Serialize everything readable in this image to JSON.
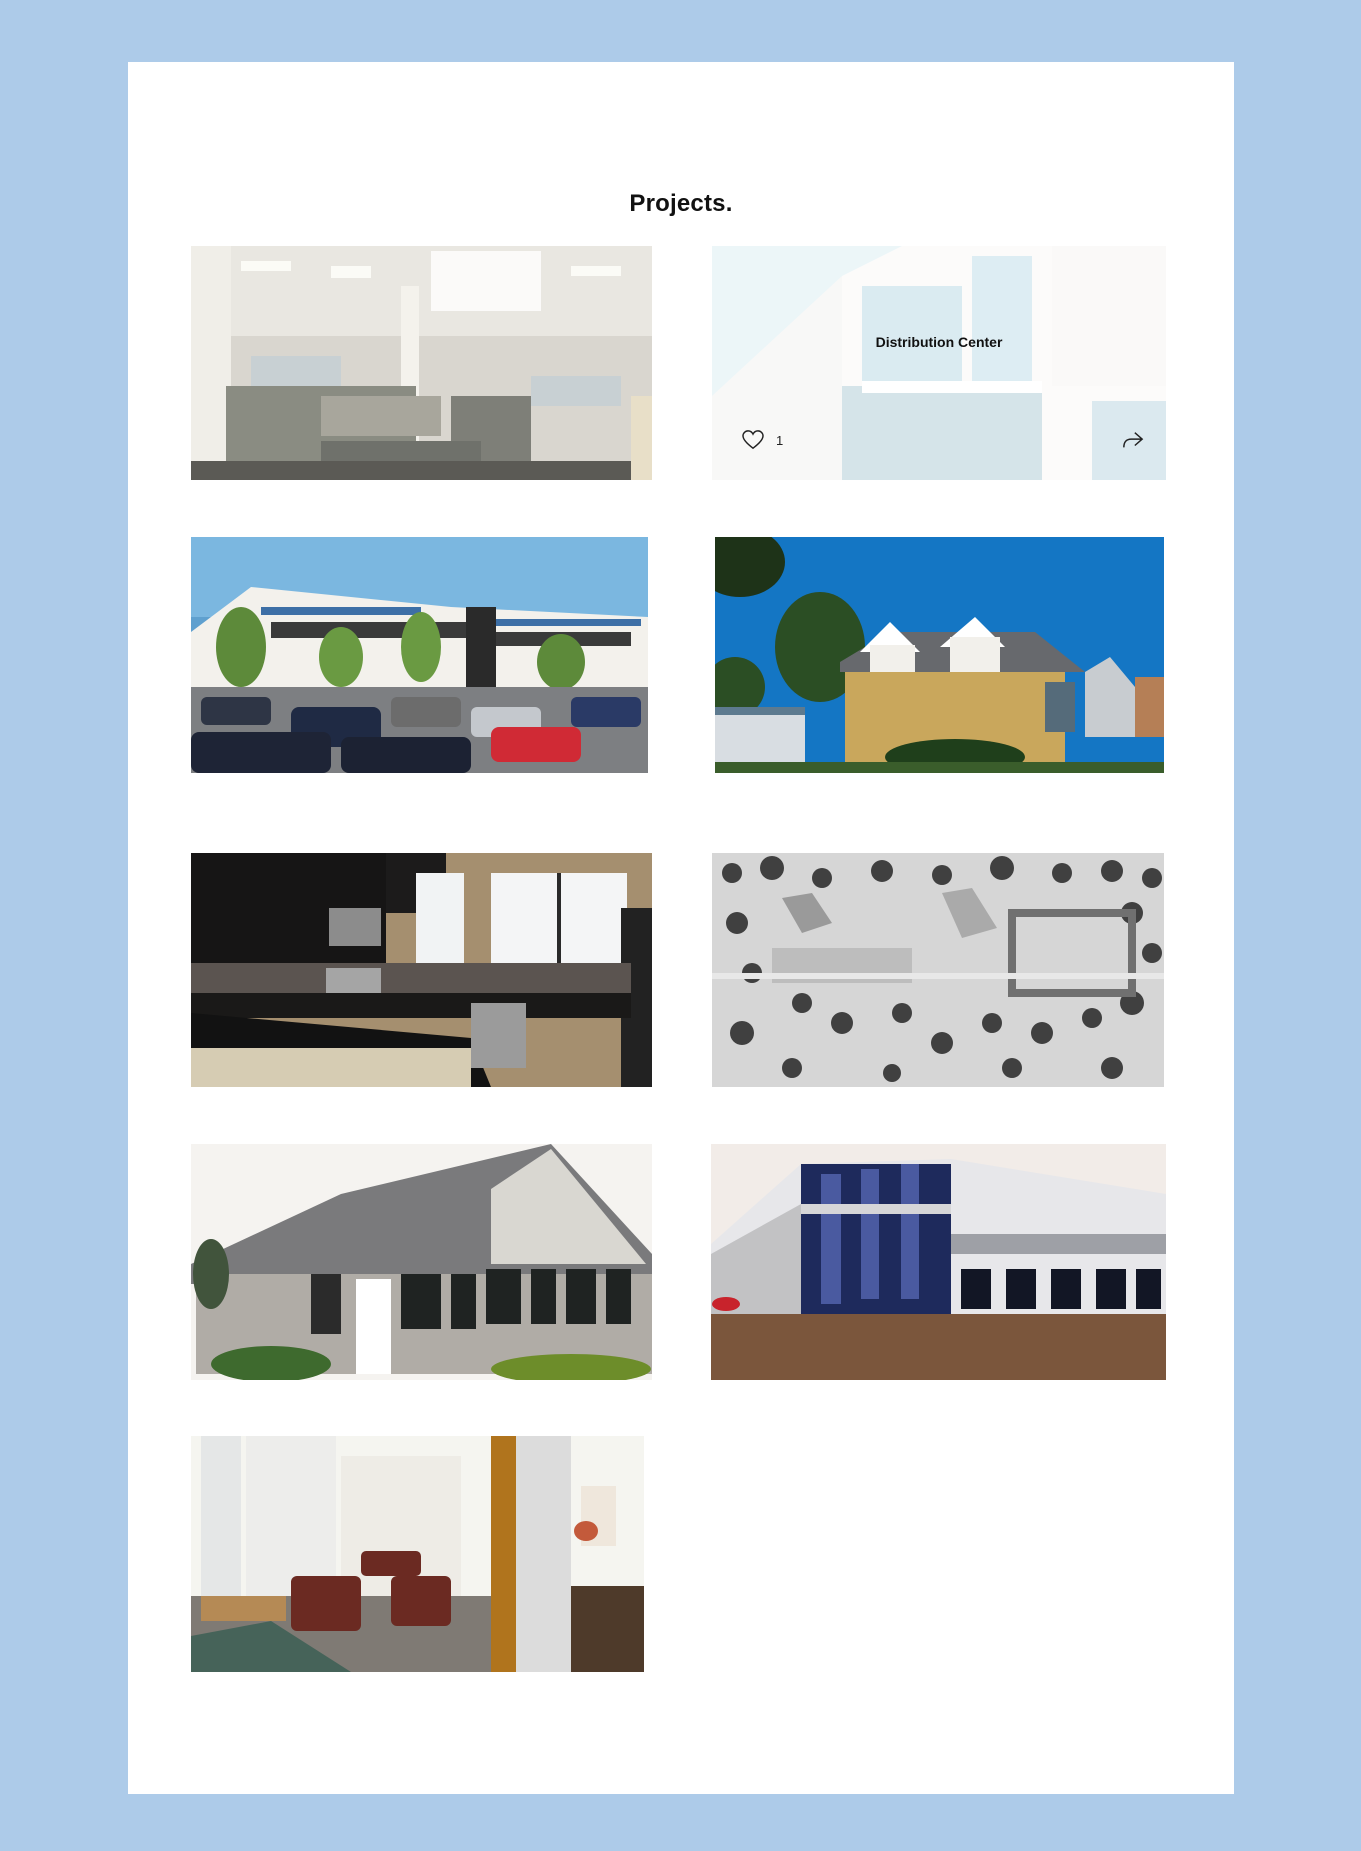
{
  "page": {
    "title": "Projects."
  },
  "gallery": {
    "items": [
      {
        "alt": "Open office interior with cubicles"
      },
      {
        "alt": "Distribution Center",
        "hover_title": "Distribution Center",
        "likes": "1"
      },
      {
        "alt": "Office park with parking lot"
      },
      {
        "alt": "Brick house with dormers"
      },
      {
        "alt": "Residential kitchen"
      },
      {
        "alt": "Site architectural model"
      },
      {
        "alt": "Sunroom addition"
      },
      {
        "alt": "Industrial building"
      },
      {
        "alt": "Lobby interior"
      }
    ]
  },
  "icons": {
    "like": "heart-icon",
    "share": "share-icon"
  },
  "colors": {
    "background": "#adcbe9",
    "panel": "#ffffff",
    "text": "#111111"
  }
}
